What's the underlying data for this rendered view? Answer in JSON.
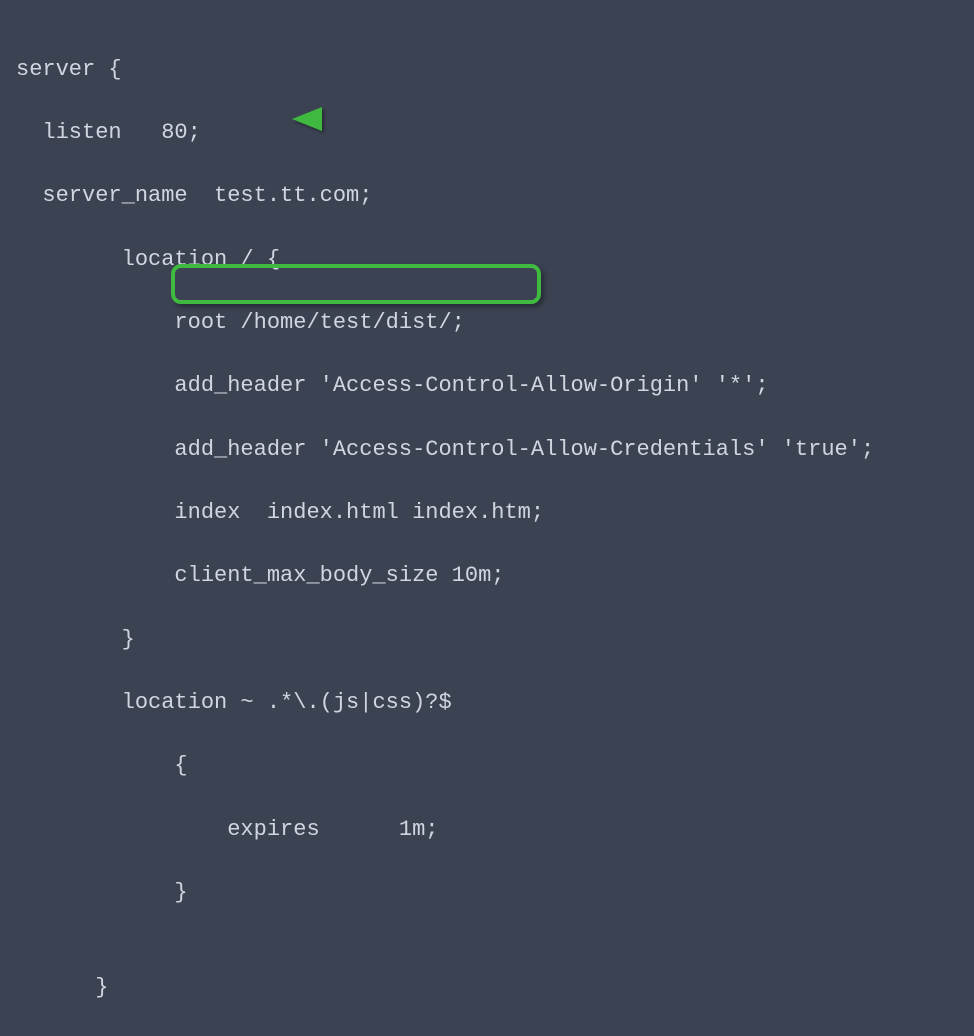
{
  "code": {
    "l1": "server {",
    "l2": "  listen   80;",
    "l3": "  server_name  test.tt.com;",
    "l4": "        location / {",
    "l5": "            root /home/test/dist/;",
    "l6": "            add_header 'Access-Control-Allow-Origin' '*';",
    "l7": "            add_header 'Access-Control-Allow-Credentials' 'true';",
    "l8": "            index  index.html index.htm;",
    "l9": "            client_max_body_size 10m;",
    "l10": "        }",
    "l11": "        location ~ .*\\.(js|css)?$",
    "l12": "            {",
    "l13": "                expires      1m;",
    "l14": "            }",
    "l15": "",
    "l16": "      }"
  },
  "annotations": {
    "highlight_target": "client_max_body_size 10m;",
    "arrow_target": "location / {",
    "highlight_color": "#3fb940",
    "arrow_color": "#3fb940"
  }
}
